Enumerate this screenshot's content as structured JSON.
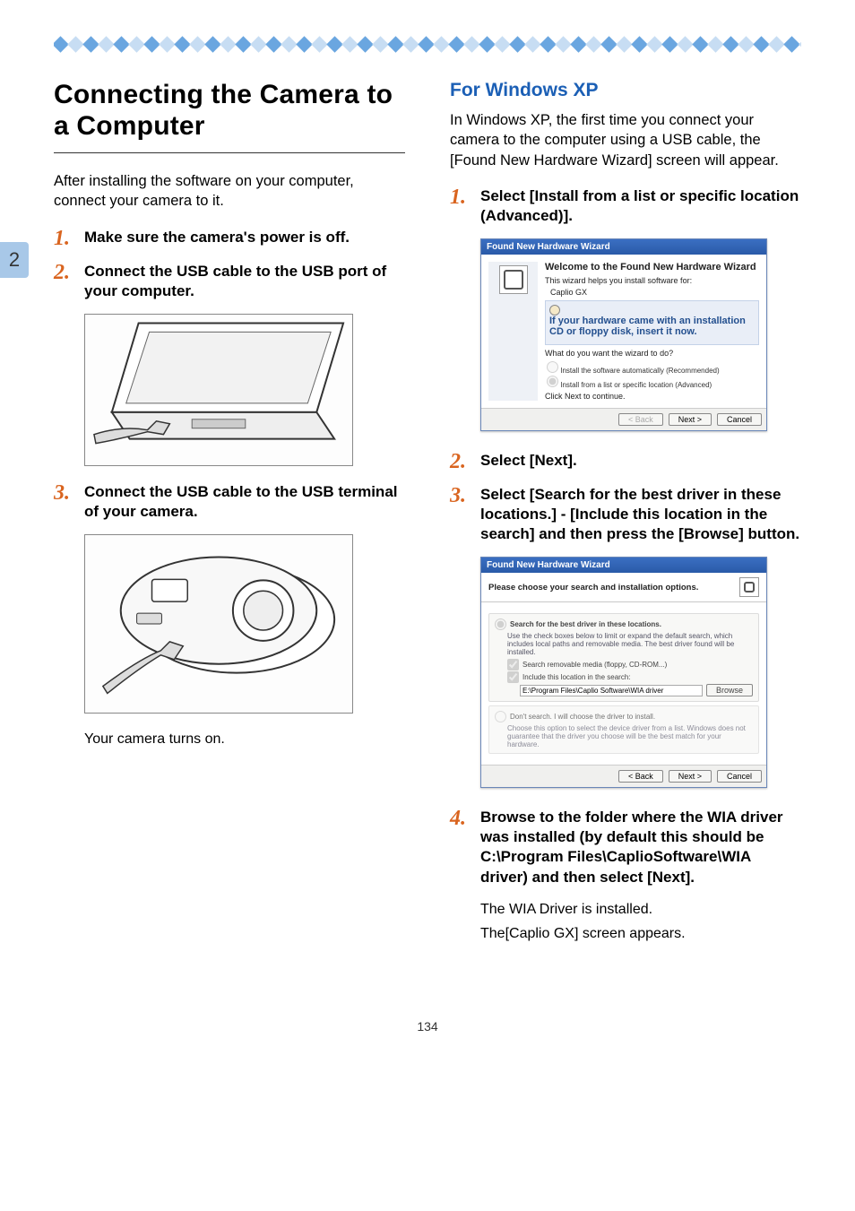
{
  "page_number": "134",
  "side_tab": "2",
  "left": {
    "title": "Connecting the Camera to a Computer",
    "intro": "After installing the software on your computer, connect your camera to it.",
    "steps": [
      {
        "text": "Make sure the camera's power is off."
      },
      {
        "text": "Connect the USB cable to the USB port of your computer."
      },
      {
        "text": "Connect the USB cable to the USB terminal of your camera."
      }
    ],
    "caption_after_step3": "Your camera turns on."
  },
  "right": {
    "subtitle": "For Windows XP",
    "intro": "In Windows XP, the first time you connect your camera to the computer using a USB cable, the [Found New Hardware Wizard] screen will appear.",
    "steps": [
      {
        "text": "Select [Install from a list or specific location (Advanced)]."
      },
      {
        "text": "Select [Next]."
      },
      {
        "text": "Select [Search for the best driver in these locations.] - [Include this location in the search] and then press the [Browse] button."
      },
      {
        "text": "Browse to the folder where the WIA driver was installed (by default this should be C:\\Program Files\\CaplioSoftware\\WIA driver) and then select [Next]."
      }
    ],
    "after_step4_line1": "The WIA Driver is installed.",
    "after_step4_line2": "The[Caplio GX] screen appears."
  },
  "wizard1": {
    "title": "Found New Hardware Wizard",
    "welcome": "Welcome to the Found New Hardware Wizard",
    "helps": "This wizard helps you install software for:",
    "device": "Caplio GX",
    "cd_hint": "If your hardware came with an installation CD or floppy disk, insert it now.",
    "question": "What do you want the wizard to do?",
    "opt1": "Install the software automatically (Recommended)",
    "opt2": "Install from a list or specific location (Advanced)",
    "cont": "Click Next to continue.",
    "back": "< Back",
    "next": "Next >",
    "cancel": "Cancel"
  },
  "wizard2": {
    "title": "Found New Hardware Wizard",
    "head": "Please choose your search and installation options.",
    "search_opt": "Search for the best driver in these locations.",
    "search_desc": "Use the check boxes below to limit or expand the default search, which includes local paths and removable media. The best driver found will be installed.",
    "chk1": "Search removable media (floppy, CD-ROM...)",
    "chk2": "Include this location in the search:",
    "path": "E:\\Program Files\\Caplio Software\\WIA driver",
    "browse": "Browse",
    "dont_opt": "Don't search. I will choose the driver to install.",
    "dont_desc": "Choose this option to select the device driver from a list. Windows does not guarantee that the driver you choose will be the best match for your hardware.",
    "back": "< Back",
    "next": "Next >",
    "cancel": "Cancel"
  }
}
